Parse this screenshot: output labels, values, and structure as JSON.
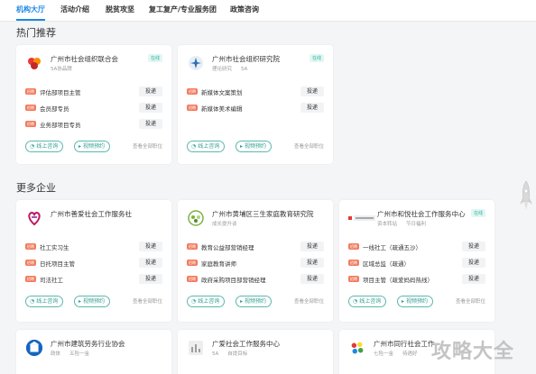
{
  "nav": {
    "items": [
      "机构大厅",
      "活动介绍",
      "脱贫攻坚",
      "复工复产/专业服务团",
      "政策咨询"
    ]
  },
  "sections": {
    "hot": "热门推荐",
    "more": "更多企业"
  },
  "common": {
    "online_consult": "线上咨询",
    "video_appointment": "视频预约",
    "view_all": "查看全部职位",
    "deliver": "投递",
    "tag": "招聘"
  },
  "cards": {
    "c1": {
      "name": "广州市社会组织联合会",
      "sub": [
        "5A协品牌"
      ],
      "badge": "在线",
      "jobs": [
        "评估部项目主管",
        "会员部专员",
        "业务部项目专员"
      ]
    },
    "c2": {
      "name": "广州市社会组织研究院",
      "sub": [
        "理论研究",
        "5A"
      ],
      "badge": "在线",
      "jobs": [
        "新媒体文案策划",
        "新媒体美术编辑"
      ]
    },
    "c3": {
      "name": "广州市善爱社会工作服务社",
      "sub": [],
      "jobs": [
        "社工实习生",
        "日托项目主管",
        "司法社工"
      ]
    },
    "c4": {
      "name": "广州市黄埔区三生家庭教育研究院",
      "sub": [
        "成长提升谈"
      ],
      "jobs": [
        "教育公益部营销经理",
        "家庭教育讲师",
        "政府采购项目部营销经理"
      ]
    },
    "c5": {
      "name": "广州市和悦社会工作服务中心",
      "sub": [
        "资本转站",
        "节日福利"
      ],
      "badge": "在线",
      "jobs": [
        "一线社工（疏通五沙）",
        "区域总监（疏通）",
        "项目主管（疏爱妈妈热线）"
      ]
    },
    "c6": {
      "name": "广州市建筑劳务行业协会",
      "sub": [
        "政体",
        "五险一金"
      ]
    },
    "c7": {
      "name": "广爱社会工作服务中心",
      "sub": [
        "5A",
        "自提目标"
      ]
    },
    "c8": {
      "name": "广州市同行社会工作",
      "sub": [
        "七险一金",
        "待遇好"
      ]
    }
  },
  "watermark": "攻略大全",
  "colors": {
    "accent": "#1e88e5",
    "teal": "#2f9e90",
    "tag": "#f27a5e"
  }
}
